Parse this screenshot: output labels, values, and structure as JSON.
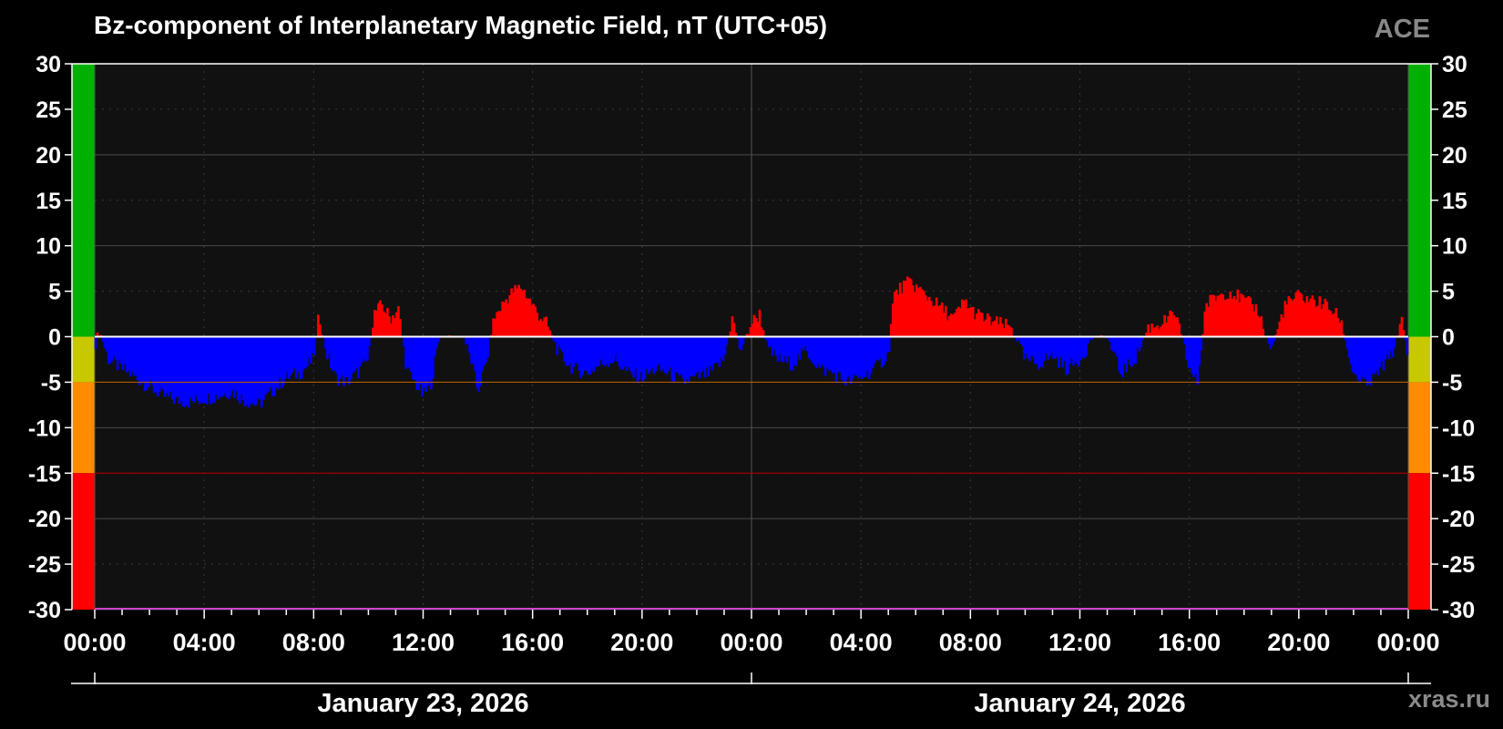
{
  "header": {
    "title": "Bz-component of Interplanetary Magnetic Field, nT (UTC+05)",
    "source": "ACE"
  },
  "footer": {
    "site": "xras.ru"
  },
  "colors": {
    "background": "#000000",
    "plot_background": "#111111",
    "positive": "#ff0000",
    "negative": "#0000ff",
    "zone_green": "#00b000",
    "zone_yellow": "#c8c800",
    "zone_orange": "#ff8c00",
    "zone_red": "#ff0000"
  },
  "chart_data": {
    "type": "area",
    "title": "Bz-component of Interplanetary Magnetic Field, nT (UTC+05)",
    "ylim": [
      -30,
      30
    ],
    "y_ticks": [
      "30",
      "25",
      "20",
      "15",
      "10",
      "5",
      "0",
      "-5",
      "-10",
      "-15",
      "-20",
      "-25",
      "-30"
    ],
    "x_range_hours": [
      0,
      48
    ],
    "x_ticks": [
      "00:00",
      "04:00",
      "08:00",
      "12:00",
      "16:00",
      "20:00",
      "00:00",
      "04:00",
      "08:00",
      "12:00",
      "16:00",
      "20:00",
      "00:00"
    ],
    "x_tick_hours": [
      0,
      4,
      8,
      12,
      16,
      20,
      24,
      28,
      32,
      36,
      40,
      44,
      48
    ],
    "date_labels": [
      {
        "label": "January 23, 2026",
        "center_hour": 12
      },
      {
        "label": "January 24, 2026",
        "center_hour": 36
      }
    ],
    "thresholds": [
      {
        "value": -5,
        "color": "#b35a00"
      },
      {
        "value": -15,
        "color": "#a00000"
      }
    ],
    "zones": [
      {
        "from": 0,
        "to": 30,
        "color": "#00b000"
      },
      {
        "from": -5,
        "to": 0,
        "color": "#c8c800"
      },
      {
        "from": -15,
        "to": -5,
        "color": "#ff8c00"
      },
      {
        "from": -30,
        "to": -15,
        "color": "#ff0000"
      }
    ],
    "grid": true,
    "series": [
      {
        "unit": "nT",
        "x": [
          0.0,
          0.15,
          0.5,
          1.0,
          1.5,
          2.0,
          2.5,
          3.0,
          3.5,
          4.0,
          4.5,
          5.0,
          5.5,
          6.0,
          6.5,
          7.0,
          7.5,
          8.0,
          8.2,
          8.5,
          8.8,
          9.2,
          9.6,
          10.0,
          10.2,
          10.5,
          10.8,
          11.1,
          11.4,
          11.7,
          12.0,
          12.3,
          12.6,
          13.0,
          13.5,
          13.8,
          14.0,
          14.3,
          14.6,
          15.0,
          15.3,
          15.6,
          15.9,
          16.2,
          16.5,
          17.0,
          17.5,
          18.0,
          18.5,
          19.0,
          19.5,
          20.0,
          20.5,
          21.0,
          21.5,
          22.0,
          22.5,
          23.0,
          23.3,
          23.6,
          24.0,
          24.3,
          24.6,
          25.0,
          25.5,
          26.0,
          26.5,
          27.0,
          27.5,
          28.0,
          28.5,
          29.0,
          29.2,
          29.5,
          29.8,
          30.2,
          30.6,
          31.0,
          31.4,
          31.8,
          32.0,
          32.5,
          33.0,
          33.5,
          34.0,
          34.5,
          35.0,
          35.5,
          36.0,
          36.5,
          37.0,
          37.5,
          38.0,
          38.5,
          39.0,
          39.5,
          40.0,
          40.3,
          40.6,
          41.0,
          41.5,
          42.0,
          42.5,
          43.0,
          43.5,
          44.0,
          44.5,
          45.0,
          45.5,
          46.0,
          46.5,
          47.0,
          47.4,
          47.8,
          48.0
        ],
        "values": [
          -1.0,
          1.0,
          -2.5,
          -3.5,
          -4.5,
          -5.5,
          -6.5,
          -7.0,
          -7.2,
          -6.8,
          -6.5,
          -6.0,
          -7.0,
          -7.5,
          -6.0,
          -4.5,
          -4.0,
          -2.5,
          2.5,
          -2.0,
          -4.5,
          -5.0,
          -4.0,
          -2.5,
          2.5,
          3.5,
          2.0,
          3.0,
          -3.5,
          -5.0,
          -6.5,
          -5.0,
          0.0,
          0.0,
          0.0,
          -3.0,
          -6.0,
          -3.0,
          2.0,
          4.0,
          5.0,
          5.5,
          4.0,
          2.5,
          1.5,
          -2.0,
          -3.5,
          -4.0,
          -3.0,
          -2.5,
          -4.0,
          -4.5,
          -3.5,
          -4.0,
          -5.0,
          -4.5,
          -4.0,
          -2.5,
          2.0,
          -1.5,
          1.5,
          2.5,
          -1.5,
          -2.5,
          -3.0,
          -1.5,
          -3.5,
          -4.0,
          -5.0,
          -4.5,
          -3.5,
          -2.0,
          4.5,
          5.5,
          6.0,
          5.0,
          4.0,
          3.0,
          2.0,
          4.0,
          3.0,
          2.0,
          1.5,
          1.0,
          -2.5,
          -3.0,
          -2.0,
          -3.5,
          -2.5,
          0.0,
          0.0,
          -4.0,
          -2.5,
          1.0,
          1.5,
          2.5,
          -3.5,
          -5.0,
          3.5,
          4.5,
          5.0,
          4.0,
          3.0,
          -1.5,
          3.5,
          4.5,
          4.0,
          3.5,
          2.0,
          -4.0,
          -5.5,
          -3.5,
          -2.0,
          2.5,
          -3.5
        ]
      }
    ]
  }
}
